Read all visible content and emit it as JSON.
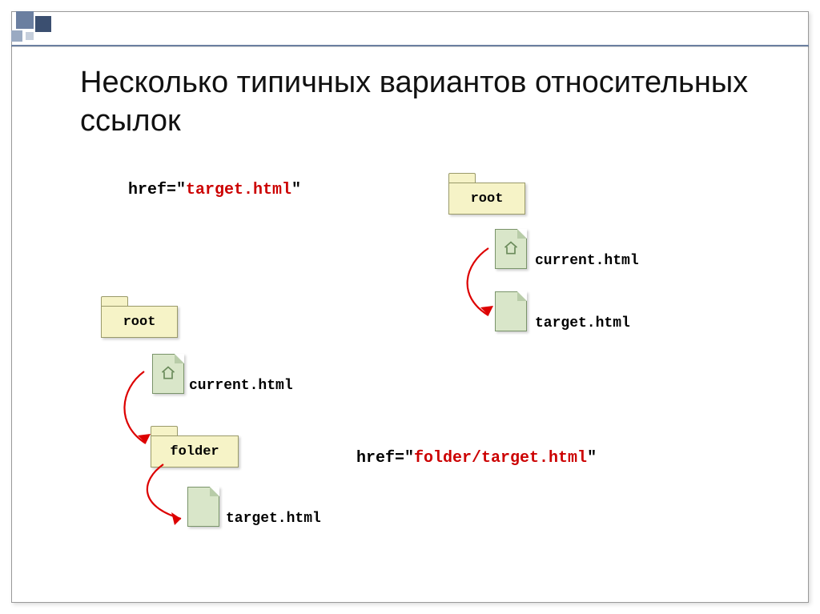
{
  "title": "Несколько типичных вариантов относительных ссылок",
  "code": {
    "ex1": {
      "prefix": "href=\"",
      "target": "target.html",
      "suffix": "\""
    },
    "ex2": {
      "prefix": "href=\"",
      "target": "folder/target.html",
      "suffix": "\""
    }
  },
  "right": {
    "root_label": "root",
    "current_label": "current.html",
    "target_label": "target.html"
  },
  "left": {
    "root_label": "root",
    "current_label": "current.html",
    "folder_label": "folder",
    "target_label": "target.html"
  }
}
